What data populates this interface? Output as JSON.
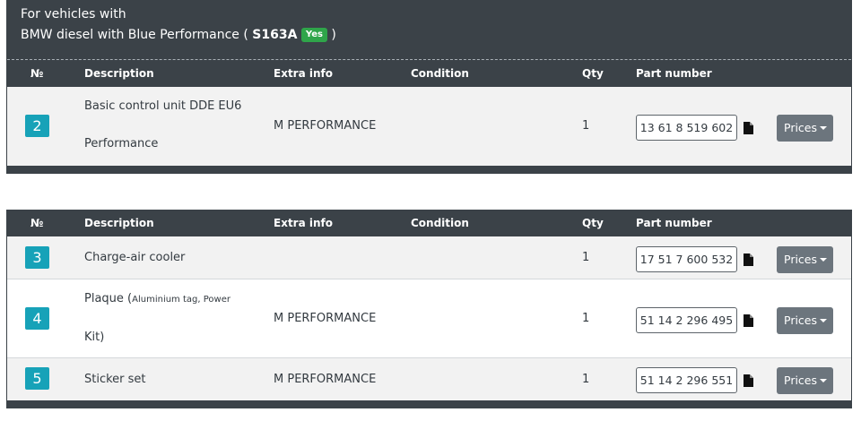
{
  "vehicle_header": {
    "line1": "For vehicles with",
    "line2_text": "BMW diesel with Blue Performance (",
    "code": "S163A",
    "badge": "Yes",
    "close": ")"
  },
  "table_headers": {
    "no": "№",
    "description": "Description",
    "extra_info": "Extra info",
    "condition": "Condition",
    "qty": "Qty",
    "part_number": "Part number"
  },
  "prices_label": "Prices",
  "icons": {
    "document": "document-icon",
    "caret": "caret-down-icon"
  },
  "colors": {
    "header_bg": "#3b4248",
    "badge_teal": "#17a2b8",
    "yes_green": "#2fa54a",
    "button_gray": "#6c757d"
  },
  "panels": [
    {
      "rows": [
        {
          "num": "2",
          "desc_line1": "Basic control unit DDE EU6",
          "desc_line2": "Performance",
          "extra": "M PERFORMANCE",
          "condition": "",
          "qty": "1",
          "part_number": "13 61 8 519 602"
        }
      ]
    },
    {
      "rows": [
        {
          "num": "3",
          "desc_line1": "Charge-air cooler",
          "extra": "",
          "condition": "",
          "qty": "1",
          "part_number": "17 51 7 600 532"
        },
        {
          "num": "4",
          "desc_main": "Plaque (",
          "desc_sub": "Aluminium tag, Power",
          "desc_line2": "Kit)",
          "extra": "M PERFORMANCE",
          "condition": "",
          "qty": "1",
          "part_number": "51 14 2 296 495"
        },
        {
          "num": "5",
          "desc_line1": "Sticker set",
          "extra": "M PERFORMANCE",
          "condition": "",
          "qty": "1",
          "part_number": "51 14 2 296 551"
        }
      ]
    }
  ]
}
